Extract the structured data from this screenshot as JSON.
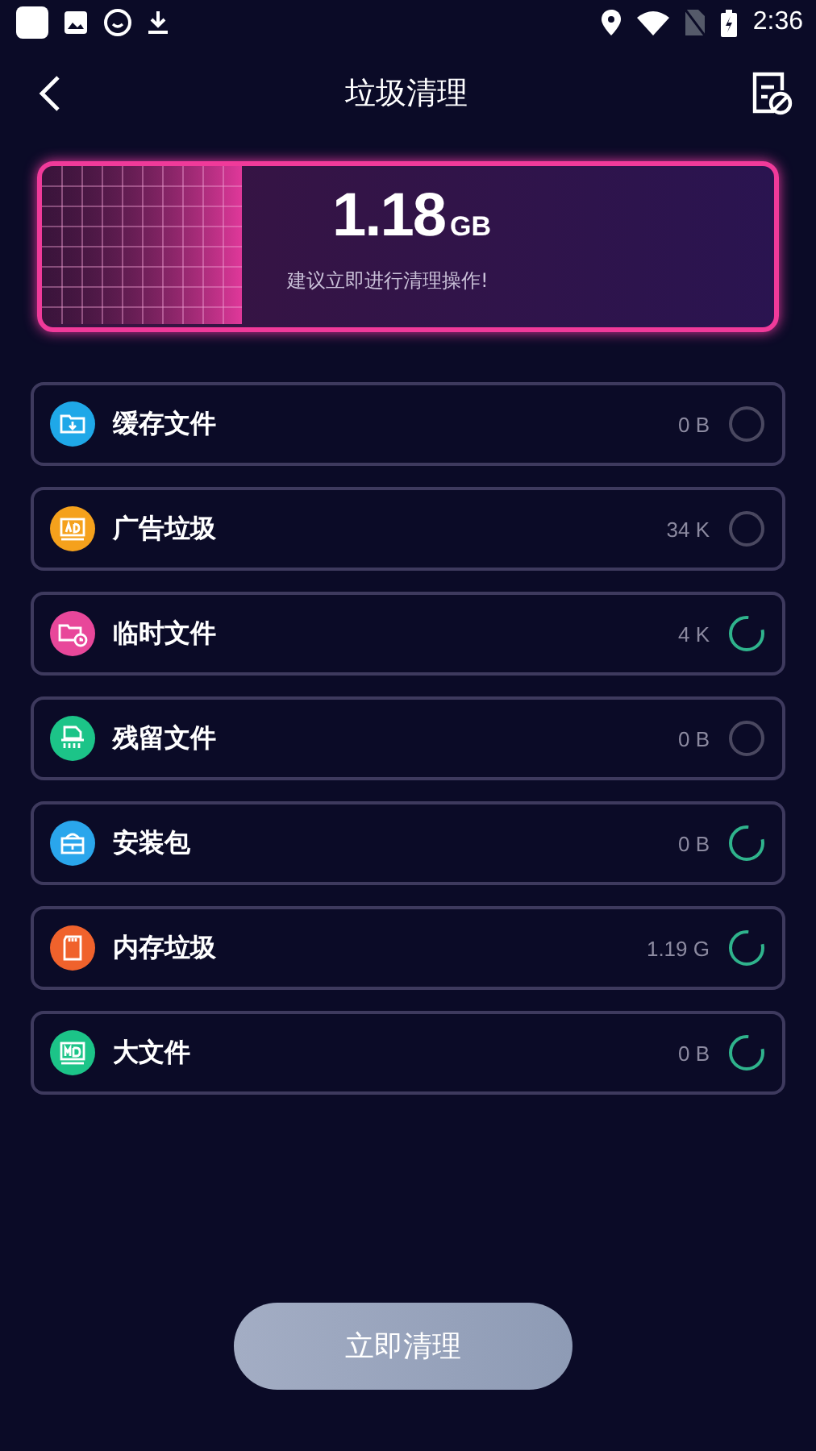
{
  "status_bar": {
    "time": "2:36"
  },
  "header": {
    "title": "垃圾清理"
  },
  "summary": {
    "size": "1.18",
    "unit": "GB",
    "hint": "建议立即进行清理操作!"
  },
  "items": [
    {
      "label": "缓存文件",
      "size": "0 B",
      "kind": "cache",
      "color": "#1fa8e8",
      "scanning": false
    },
    {
      "label": "广告垃圾",
      "size": "34 K",
      "kind": "ad",
      "color": "#f5a11c",
      "scanning": false
    },
    {
      "label": "临时文件",
      "size": "4 K",
      "kind": "temp",
      "color": "#e8479a",
      "scanning": true
    },
    {
      "label": "残留文件",
      "size": "0 B",
      "kind": "residue",
      "color": "#1cc488",
      "scanning": false
    },
    {
      "label": "安装包",
      "size": "0 B",
      "kind": "package",
      "color": "#2aa6ec",
      "scanning": true
    },
    {
      "label": "内存垃圾",
      "size": "1.19 G",
      "kind": "memory",
      "color": "#f0622c",
      "scanning": true
    },
    {
      "label": "大文件",
      "size": "0 B",
      "kind": "large",
      "color": "#1cc488",
      "scanning": true
    }
  ],
  "clean_button": {
    "label": "立即清理"
  }
}
